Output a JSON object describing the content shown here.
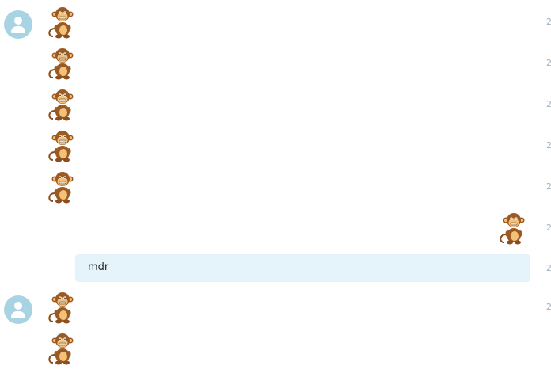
{
  "conversation": {
    "messages": [
      {
        "sender": "other",
        "kind": "sticker",
        "sticker": "monkey-sticker",
        "timestamp": "2"
      },
      {
        "sender": "other",
        "kind": "sticker",
        "sticker": "monkey-sticker",
        "timestamp": "2"
      },
      {
        "sender": "other",
        "kind": "sticker",
        "sticker": "monkey-sticker",
        "timestamp": "2"
      },
      {
        "sender": "other",
        "kind": "sticker",
        "sticker": "monkey-sticker",
        "timestamp": "2"
      },
      {
        "sender": "other",
        "kind": "sticker",
        "sticker": "monkey-sticker",
        "timestamp": "2"
      },
      {
        "sender": "self",
        "kind": "sticker",
        "sticker": "monkey-sticker",
        "timestamp": "2"
      },
      {
        "sender": "self",
        "kind": "text",
        "text": "mdr",
        "timestamp": "2"
      },
      {
        "sender": "other",
        "kind": "sticker",
        "sticker": "monkey-sticker",
        "timestamp": "2"
      },
      {
        "sender": "other",
        "kind": "sticker",
        "sticker": "monkey-sticker",
        "timestamp": ""
      }
    ]
  },
  "colors": {
    "avatar_bg": "#a7d3e2",
    "bubble_bg": "#e5f4fb",
    "timestamp": "#9fb3bf"
  },
  "icons": {
    "avatar": "user-avatar-icon",
    "sticker": "monkey-sticker"
  }
}
